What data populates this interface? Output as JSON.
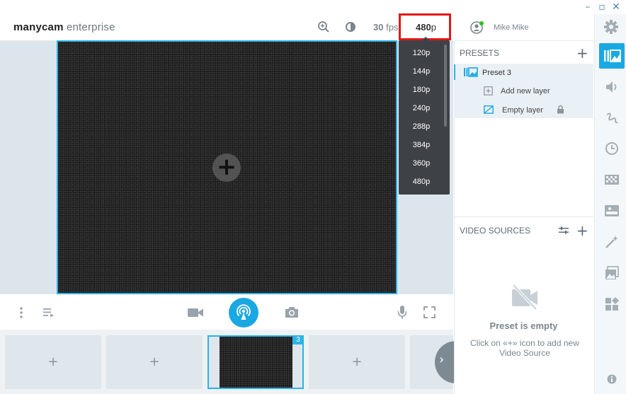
{
  "app": {
    "logo_bold": "manycam",
    "logo_light": " enterprise"
  },
  "window_controls": [
    "minimize",
    "maximize",
    "close"
  ],
  "header": {
    "fps_value": "30",
    "fps_unit": " fps",
    "resolution_value": "480",
    "resolution_unit": "p",
    "user_name": "Mike Mike"
  },
  "resolution_menu": {
    "options": [
      "120p",
      "144p",
      "180p",
      "240p",
      "288p",
      "384p",
      "360p",
      "480p"
    ]
  },
  "presets_panel": {
    "title": "PRESETS",
    "preset_name": "Preset 3",
    "add_layer_label": "Add new layer",
    "empty_layer_label": "Empty layer"
  },
  "video_sources_panel": {
    "title": "VIDEO SOURCES",
    "empty_title": "Preset is empty",
    "empty_hint": "Click on «+» icon to add new Video Source"
  },
  "preset_strip": {
    "active_badge": "3"
  },
  "colors": {
    "accent": "#1aa8e3",
    "highlight_box": "#e11919"
  }
}
